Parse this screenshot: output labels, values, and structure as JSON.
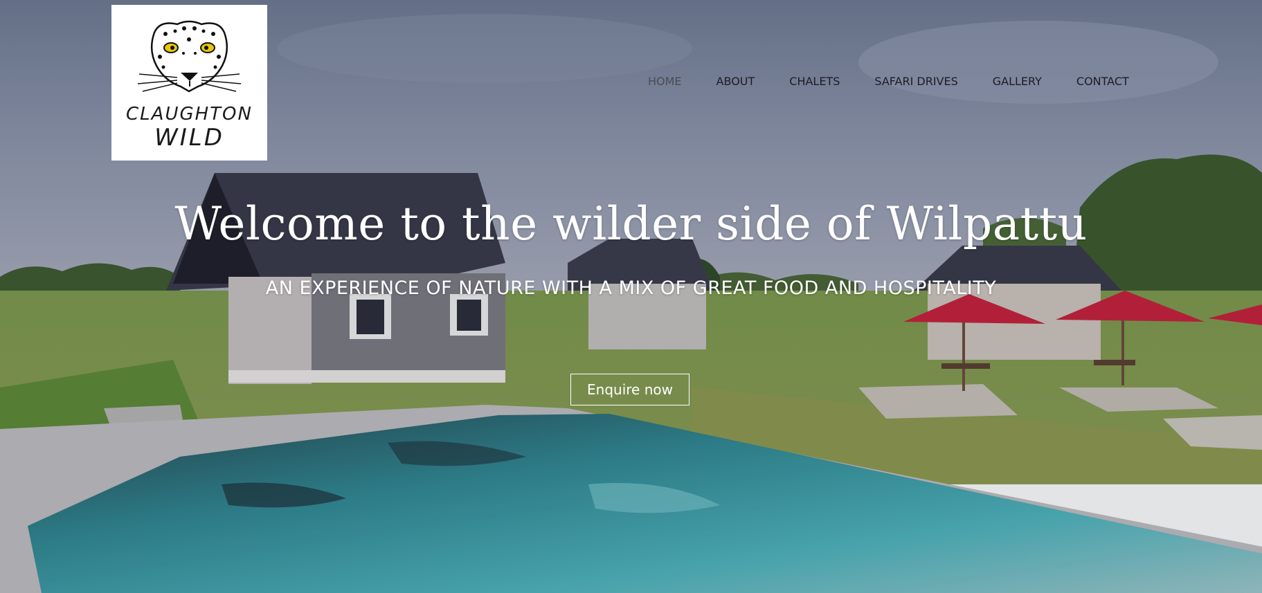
{
  "brand": {
    "logo_line1": "CLAUGHTON",
    "logo_line2": "WILD"
  },
  "nav": {
    "items": [
      {
        "label": "HOME",
        "active": true
      },
      {
        "label": "ABOUT",
        "active": false
      },
      {
        "label": "CHALETS",
        "active": false
      },
      {
        "label": "SAFARI DRIVES",
        "active": false
      },
      {
        "label": "GALLERY",
        "active": false
      },
      {
        "label": "CONTACT",
        "active": false
      }
    ]
  },
  "hero": {
    "headline": "Welcome to the wilder side of Wilpattu",
    "subheadline": "AN EXPERIENCE OF NATURE WITH A MIX OF GREAT FOOD AND HOSPITALITY",
    "cta_label": "Enquire now"
  },
  "colors": {
    "nav_text": "#1c1c24",
    "nav_active": "#4a4a55",
    "hero_text": "#ffffff",
    "pool": "#3ba6b0",
    "umbrella": "#c6203a"
  },
  "icons": {
    "logo": "leopard-face-icon"
  }
}
